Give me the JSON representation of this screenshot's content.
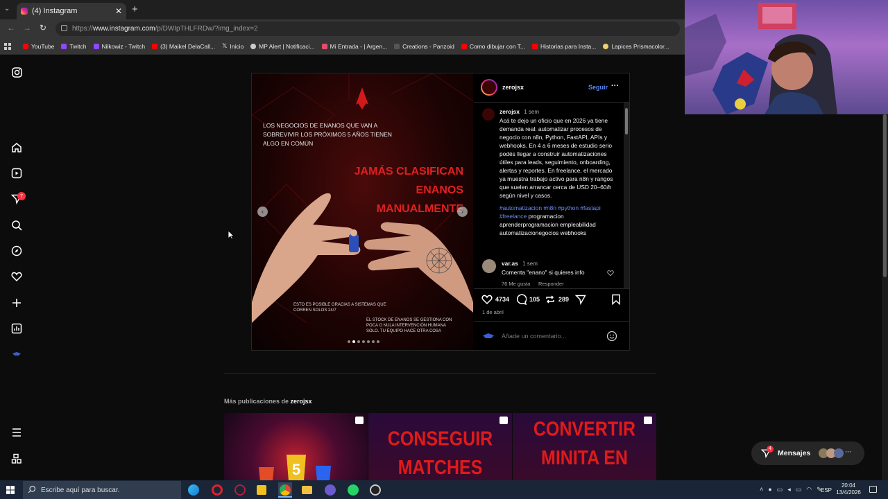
{
  "browser": {
    "tab_title": "(4) Instagram",
    "url_prefix": "https://",
    "url_host": "www.instagram.com",
    "url_path": "/p/DWIpTHLFRDw/?img_index=2",
    "bookmarks": [
      {
        "label": "YouTube",
        "color": "#ff0000"
      },
      {
        "label": "Twitch",
        "color": "#9146ff"
      },
      {
        "label": "Nilkowiz - Twitch",
        "color": "#9146ff"
      },
      {
        "label": "(3) Maikel DelaCall...",
        "color": "#ff0000"
      },
      {
        "label": "Inicio",
        "color": "#ffffff"
      },
      {
        "label": "MP Alert | Notificaci...",
        "color": "#cccccc"
      },
      {
        "label": "Mi Entrada - | Argen...",
        "color": "#e34d6b"
      },
      {
        "label": "Creations - Panzoid",
        "color": "#333333"
      },
      {
        "label": "Como dibujar con T...",
        "color": "#ff0000"
      },
      {
        "label": "Historias para Insta...",
        "color": "#ff0000"
      },
      {
        "label": "Lapices Prismacolor...",
        "color": "#f0d070"
      }
    ]
  },
  "nav": {
    "notifications_badge": "7"
  },
  "post": {
    "username": "zerojsx",
    "follow_label": "Seguir",
    "more_label": "···",
    "caption_user": "zerojsx",
    "caption_time": "1 sem",
    "caption_text": "Acá te dejo un oficio que en 2026 ya tiene demanda real: automatizar procesos de negocio con n8n, Python, FastAPI, APIs y webhooks. En 4 a 6 meses de estudio serio podés llegar a construir automatizaciones útiles para leads, seguimiento, onboarding, alertas y reportes. En freelance, el mercado ya muestra trabajo activo para n8n y rangos que suelen arrancar cerca de USD 20–60/h según nivel y casos.",
    "hashtags": "#automatizacion #n8n #python #fastapi #freelance",
    "caption_tail": "programacion aprenderprogramacion empleabilidad automatizacionegocios webhooks",
    "comment_user": "var.as",
    "comment_time": "1 sem",
    "comment_text": "Comenta \"enano\" si quieres info",
    "comment_likes": "76 Me gusta",
    "comment_reply": "Responder",
    "likes": "4734",
    "comments": "105",
    "reposts": "289",
    "date": "1 de abril",
    "comment_placeholder": "Añade un comentario...",
    "media": {
      "subtitle": "LOS NEGOCIOS DE ENANOS QUE VAN A SOBREVIVIR LOS PRÓXIMOS 5 AÑOS TIENEN ALGO EN COMÚN",
      "headline_1": "JAMÁS CLASIFICAN",
      "headline_2": "ENANOS",
      "headline_3": "MANUALMENTE",
      "note_1": "ESTO ES POSIBLE GRACIAS A SISTEMAS QUE CORREN SOLOS 24/7",
      "note_2": "EL STOCK DE ENANOS SE GESTIONA CON POCA O NULA INTERVENCIÓN HUMANA SOLO. TU EQUIPO HACE OTRA COSA",
      "slide_index": 2,
      "slide_count": 7
    }
  },
  "more_posts": {
    "label": "Más publicaciones de",
    "user": "zerojsx",
    "thumbs": [
      {
        "text": ""
      },
      {
        "text": "CONSEGUIR MATCHES"
      },
      {
        "text": "CONVERTIR MINITA EN"
      }
    ]
  },
  "messages": {
    "label": "Mensajes",
    "badge": "4"
  },
  "taskbar": {
    "search_placeholder": "Escribe aquí para buscar.",
    "lang": "ESP",
    "time": "20:04",
    "date": "13/4/2026"
  }
}
